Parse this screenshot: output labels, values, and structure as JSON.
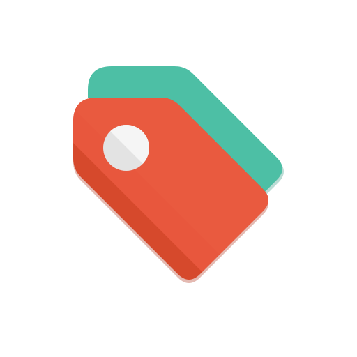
{
  "icon": {
    "name": "price-tags-icon",
    "colors": {
      "background": "#ffffff",
      "back_tag": "#4DBFA5",
      "back_tag_shadow": "#3D9C86",
      "front_tag_light": "#E8573D",
      "front_tag_dark": "#D6492C",
      "front_tag_shadow": "#B23A22",
      "hole_light": "#F5F5F5",
      "hole_dark": "#E3E3E3"
    }
  }
}
